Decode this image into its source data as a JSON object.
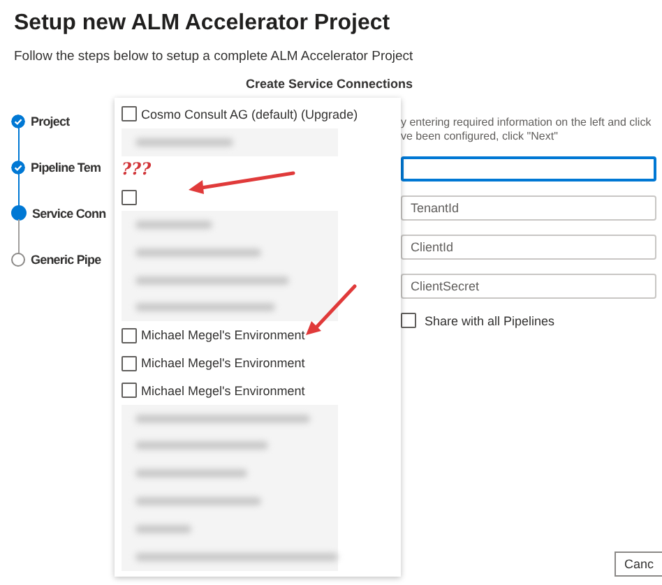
{
  "header": {
    "title": "Setup new ALM Accelerator Project",
    "subtitle": "Follow the steps below to setup a complete ALM Accelerator Project"
  },
  "steps": [
    {
      "label": "Project",
      "completed": true,
      "current": false
    },
    {
      "label": "Pipeline Tem",
      "completed": true,
      "current": false
    },
    {
      "label": "Service Conn",
      "completed": false,
      "current": true
    },
    {
      "label": "Generic Pipe",
      "completed": false,
      "current": false
    }
  ],
  "panel": {
    "heading": "Create Service Connections",
    "description": [
      "y entering required information on the left and click",
      "ve been configured, click \"Next\""
    ],
    "fields": [
      {
        "focused": true
      },
      {
        "placeholder": "TenantId",
        "focused": false
      },
      {
        "placeholder": "ClientId",
        "focused": false
      },
      {
        "placeholder": "ClientSecret",
        "focused": false
      }
    ],
    "share_checkbox": {
      "label": "Share with all Pipelines",
      "checked": false
    },
    "cancel_button": "Canc"
  },
  "dropdown": {
    "items": [
      {
        "kind": "option",
        "label": "Cosmo Consult AG (default) (Upgrade)",
        "checked": false,
        "marked": false
      },
      {
        "kind": "blurred"
      },
      {
        "kind": "annotation",
        "text": "???"
      },
      {
        "kind": "option",
        "checked": false,
        "marked": true
      },
      {
        "kind": "blurred"
      },
      {
        "kind": "blurred"
      },
      {
        "kind": "blurred"
      },
      {
        "kind": "blurred"
      },
      {
        "kind": "option",
        "label": "Michael Megel's Environment",
        "checked": false,
        "marked": true
      },
      {
        "kind": "option",
        "label": "Michael Megel's Environment",
        "checked": false,
        "marked": false
      },
      {
        "kind": "option",
        "label": "Michael Megel's Environment",
        "checked": false,
        "marked": false
      },
      {
        "kind": "blurred"
      },
      {
        "kind": "blurred"
      },
      {
        "kind": "blurred"
      },
      {
        "kind": "blurred"
      },
      {
        "kind": "blurred"
      },
      {
        "kind": "blurred"
      }
    ]
  }
}
